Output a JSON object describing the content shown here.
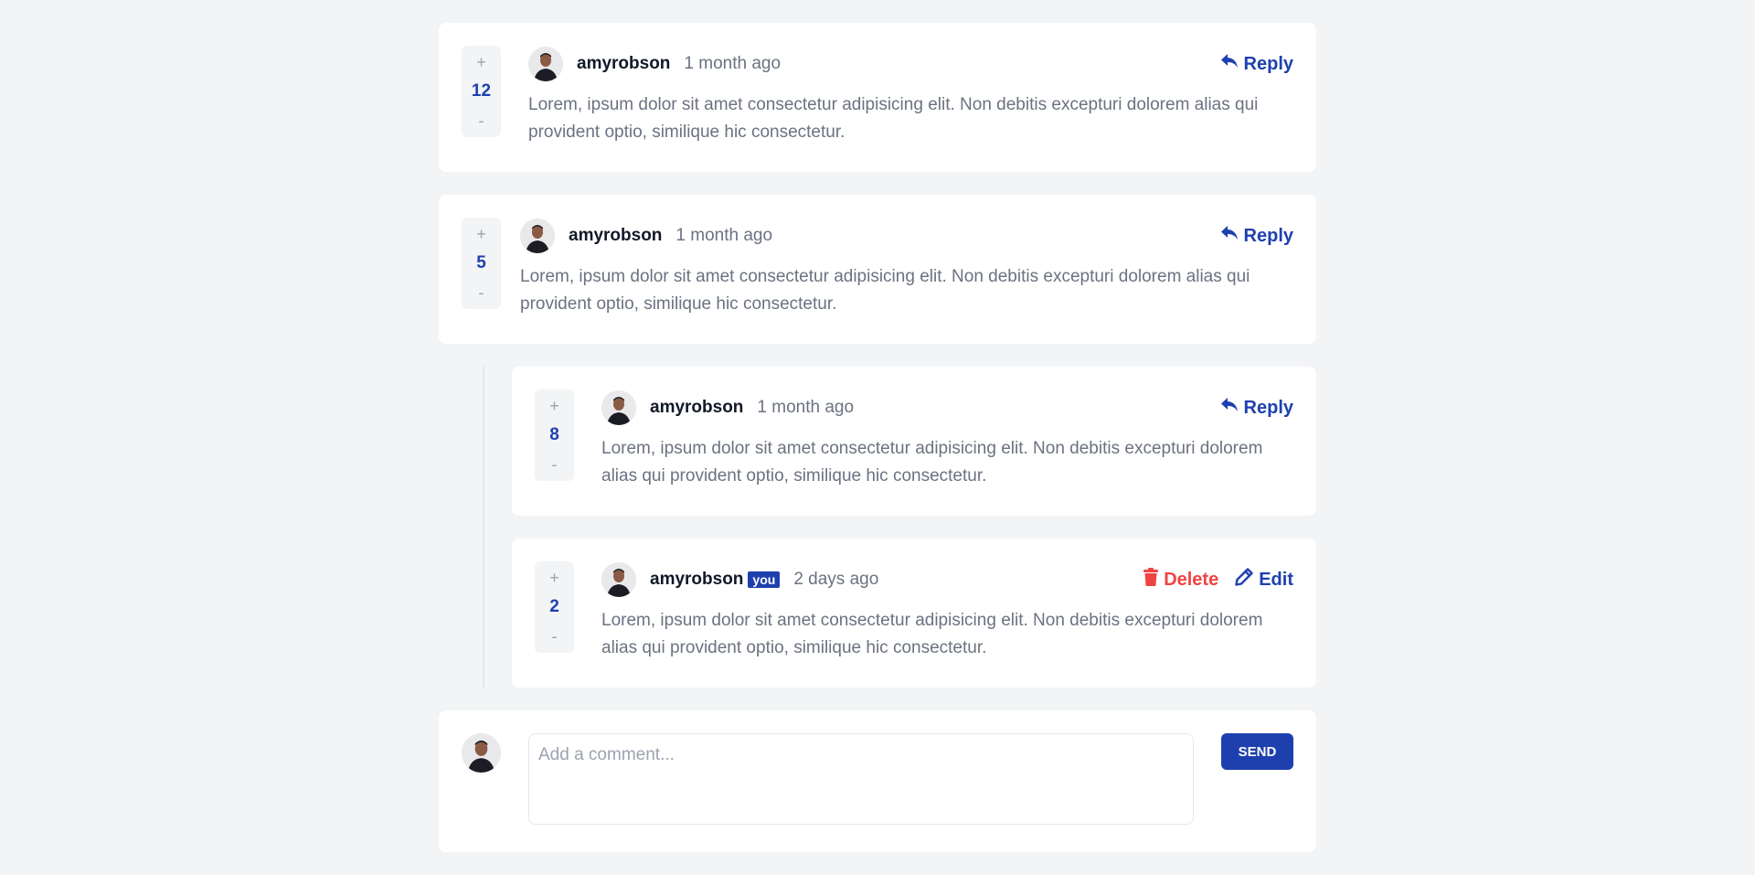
{
  "colors": {
    "accent": "#1e40af",
    "danger": "#ef4444",
    "background": "#f3f4f6",
    "card": "#ffffff",
    "muted_text": "#6b7280"
  },
  "comments": [
    {
      "score": "12",
      "upvote": "+",
      "downvote": "-",
      "username": "amyrobson",
      "time": "1 month ago",
      "reply_label": "Reply",
      "reply_icon": "reply-arrow-icon",
      "text": "Lorem, ipsum dolor sit amet consectetur adipisicing elit. Non debitis excepturi dolorem alias qui provident optio, similique hic consectetur."
    },
    {
      "score": "5",
      "upvote": "+",
      "downvote": "-",
      "username": "amyrobson",
      "time": "1 month ago",
      "reply_label": "Reply",
      "reply_icon": "reply-arrow-icon",
      "text": "Lorem, ipsum dolor sit amet consectetur adipisicing elit. Non debitis excepturi dolorem alias qui provident optio, similique hic consectetur.",
      "replies": [
        {
          "score": "8",
          "upvote": "+",
          "downvote": "-",
          "username": "amyrobson",
          "time": "1 month ago",
          "reply_label": "Reply",
          "reply_icon": "reply-arrow-icon",
          "text": "Lorem, ipsum dolor sit amet consectetur adipisicing elit. Non debitis excepturi dolorem alias qui provident optio, similique hic consectetur."
        },
        {
          "score": "2",
          "upvote": "+",
          "downvote": "-",
          "username": "amyrobson",
          "you_badge": "you",
          "time": "2 days ago",
          "delete_label": "Delete",
          "delete_icon": "trash-icon",
          "edit_label": "Edit",
          "edit_icon": "pencil-icon",
          "text": "Lorem, ipsum dolor sit amet consectetur adipisicing elit. Non debitis excepturi dolorem alias qui provident optio, similique hic consectetur."
        }
      ]
    }
  ],
  "composer": {
    "placeholder": "Add a comment...",
    "value": "",
    "send_label": "SEND"
  }
}
